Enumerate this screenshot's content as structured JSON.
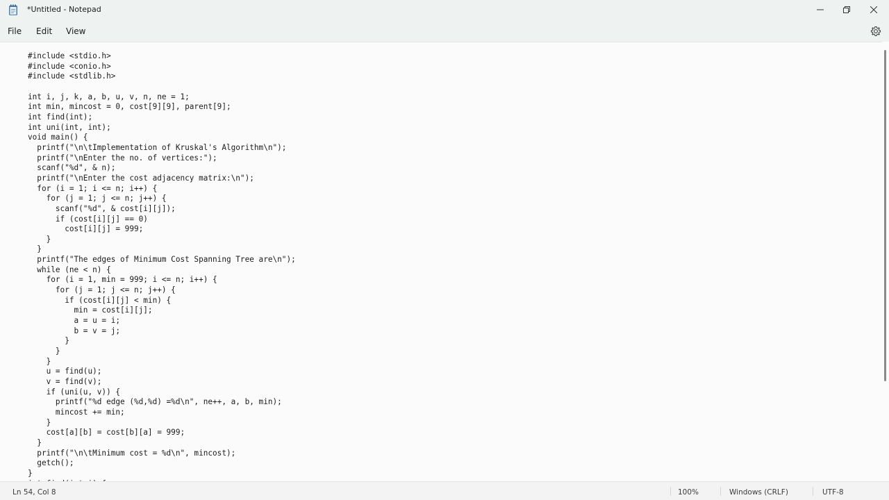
{
  "window": {
    "title": "*Untitled - Notepad"
  },
  "menu": {
    "file": "File",
    "edit": "Edit",
    "view": "View"
  },
  "editor": {
    "content": "#include <stdio.h>\n#include <conio.h>\n#include <stdlib.h>\n\nint i, j, k, a, b, u, v, n, ne = 1;\nint min, mincost = 0, cost[9][9], parent[9];\nint find(int);\nint uni(int, int);\nvoid main() {\n  printf(\"\\n\\tImplementation of Kruskal's Algorithm\\n\");\n  printf(\"\\nEnter the no. of vertices:\");\n  scanf(\"%d\", & n);\n  printf(\"\\nEnter the cost adjacency matrix:\\n\");\n  for (i = 1; i <= n; i++) {\n    for (j = 1; j <= n; j++) {\n      scanf(\"%d\", & cost[i][j]);\n      if (cost[i][j] == 0)\n        cost[i][j] = 999;\n    }\n  }\n  printf(\"The edges of Minimum Cost Spanning Tree are\\n\");\n  while (ne < n) {\n    for (i = 1, min = 999; i <= n; i++) {\n      for (j = 1; j <= n; j++) {\n        if (cost[i][j] < min) {\n          min = cost[i][j];\n          a = u = i;\n          b = v = j;\n        }\n      }\n    }\n    u = find(u);\n    v = find(v);\n    if (uni(u, v)) {\n      printf(\"%d edge (%d,%d) =%d\\n\", ne++, a, b, min);\n      mincost += min;\n    }\n    cost[a][b] = cost[b][a] = 999;\n  }\n  printf(\"\\n\\tMinimum cost = %d\\n\", mincost);\n  getch();\n}\nint find(int i) {"
  },
  "status": {
    "position": "Ln 54, Col 8",
    "zoom": "100%",
    "line_ending": "Windows (CRLF)",
    "encoding": "UTF-8"
  },
  "icons": {
    "app": "notepad-icon",
    "minimize": "minimize-icon",
    "maximize": "restore-icon",
    "close": "close-icon",
    "settings": "gear-icon"
  }
}
